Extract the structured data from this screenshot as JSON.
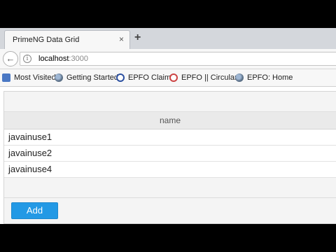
{
  "browser": {
    "tab": {
      "title": "PrimeNG Data Grid",
      "close": "×"
    },
    "new_tab": "+",
    "url": {
      "host": "localhost",
      "port": ":3000"
    },
    "bookmarks": [
      {
        "label": "Most Visited",
        "icon": "most-visited-icon"
      },
      {
        "label": "Getting Started",
        "icon": "globe-icon"
      },
      {
        "label": "EPFO Claim",
        "icon": "epfo-logo-icon"
      },
      {
        "label": "EPFO || Circulars",
        "icon": "epfo-logo-icon"
      },
      {
        "label": "EPFO: Home",
        "icon": "globe-icon"
      }
    ]
  },
  "grid": {
    "column_header": "name",
    "rows": [
      "javainuse1",
      "javainuse2",
      "javainuse4"
    ]
  },
  "add_button": "Add",
  "colors": {
    "accent": "#2399e5",
    "header_bg": "#eaeaea"
  }
}
